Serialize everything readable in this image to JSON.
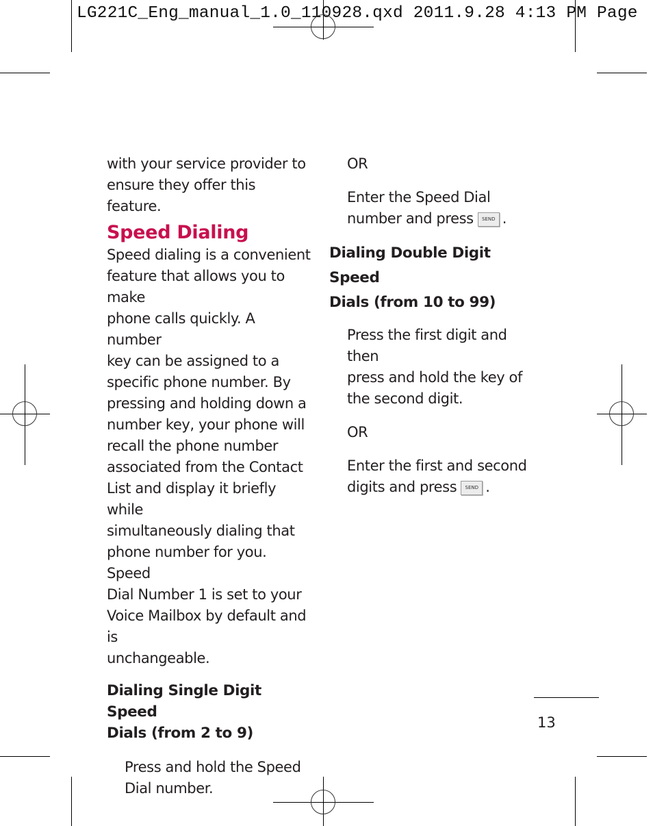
{
  "slug_line": "LG221C_Eng_manual_1.0_110928.qxd  2011.9.28  4:13 PM  Page",
  "left_column": {
    "intro": [
      "with your service provider to",
      "ensure they offer this feature."
    ],
    "heading": "Speed Dialing",
    "body": [
      "Speed dialing is a convenient",
      "feature that allows you to make",
      "phone calls quickly. A number",
      "key can be assigned to a",
      "specific phone number. By",
      "pressing and holding down a",
      "number key, your phone will",
      "recall the phone number",
      "associated from the Contact",
      "List and display it briefly while",
      "simultaneously dialing that",
      "phone number for you. Speed",
      "Dial Number 1 is set to your",
      "Voice Mailbox by default and is",
      "unchangeable."
    ],
    "subheading": [
      "Dialing Single Digit Speed",
      "Dials (from 2 to 9)"
    ],
    "step": [
      "Press and hold the Speed",
      "Dial number."
    ]
  },
  "right_column": {
    "or1": "OR",
    "alt1": [
      "Enter the Speed Dial",
      "number and press"
    ],
    "subheading": [
      "Dialing Double Digit Speed",
      "Dials (from 10 to 99)"
    ],
    "step": [
      "Press the first digit and then",
      "press and hold the key of",
      "the second digit."
    ],
    "or2": "OR",
    "alt2": [
      "Enter the first and second",
      "digits and press"
    ],
    "period": "."
  },
  "send_key_label": "SEND",
  "page_number": "13"
}
